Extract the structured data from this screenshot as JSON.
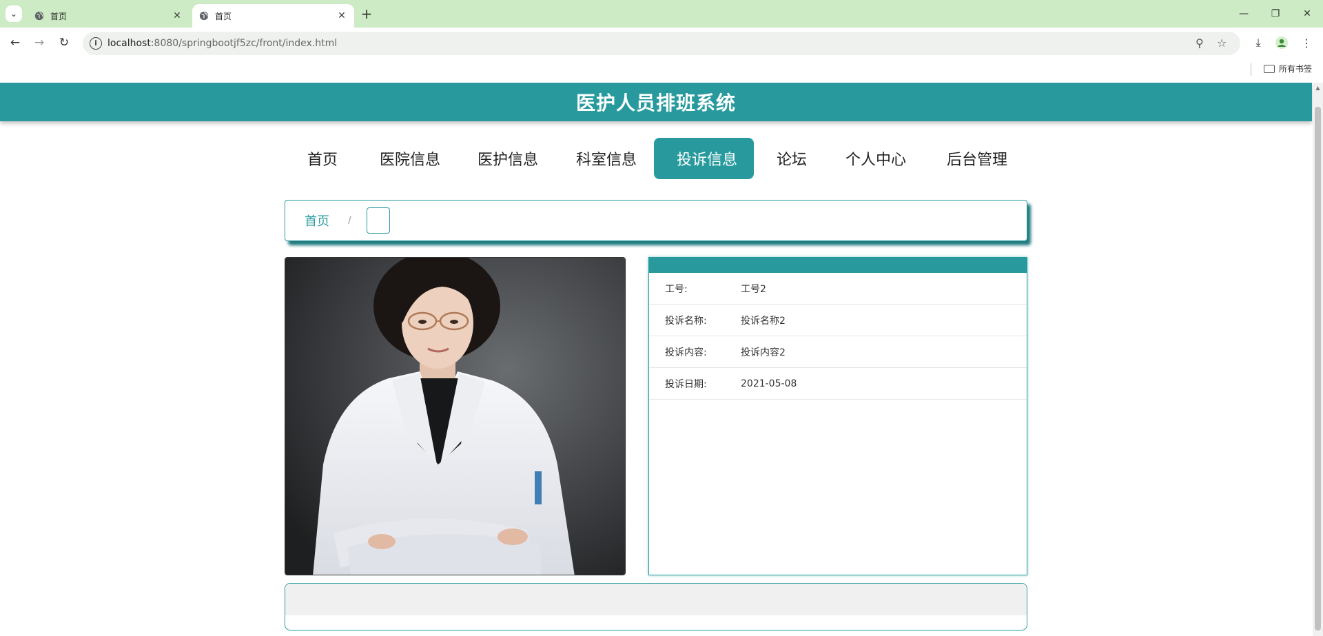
{
  "browser": {
    "tabs": [
      {
        "title": "首页"
      },
      {
        "title": "首页"
      }
    ],
    "url_host": "localhost",
    "url_path": ":8080/springbootjf5zc/front/index.html",
    "bookmarks_label": "所有书签"
  },
  "site": {
    "title": "医护人员排班系统",
    "accent_color": "#289a9e",
    "nav": [
      {
        "label": "首页"
      },
      {
        "label": "医院信息"
      },
      {
        "label": "医护信息"
      },
      {
        "label": "科室信息"
      },
      {
        "label": "投诉信息"
      },
      {
        "label": "论坛"
      },
      {
        "label": "个人中心"
      },
      {
        "label": "后台管理"
      }
    ],
    "active_nav": "投诉信息"
  },
  "breadcrumb": {
    "home": "首页",
    "separator": "/"
  },
  "detail": {
    "rows": [
      {
        "label": "工号:",
        "value": "工号2"
      },
      {
        "label": "投诉名称:",
        "value": "投诉名称2"
      },
      {
        "label": "投诉内容:",
        "value": "投诉内容2"
      },
      {
        "label": "投诉日期:",
        "value": "2021-05-08"
      }
    ]
  }
}
